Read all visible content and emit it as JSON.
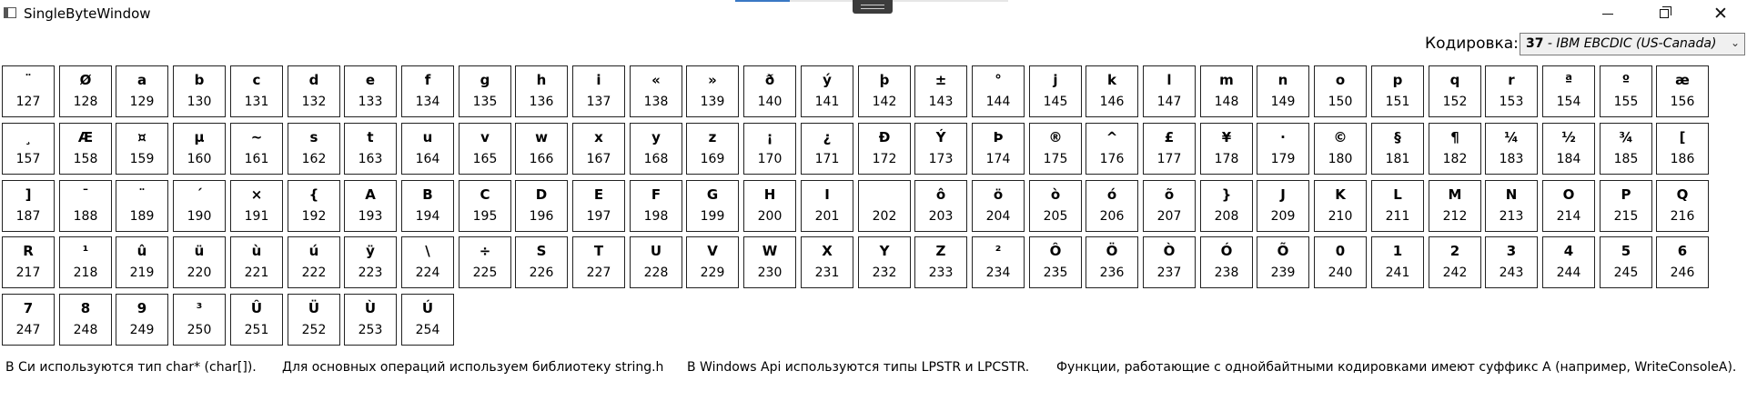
{
  "window": {
    "title": "SingleByteWindow",
    "close_glyph": "✕"
  },
  "encoding": {
    "label": "Кодировка:",
    "selected_number": "37",
    "selected_name": " - IBM EBCDIC (US-Canada)",
    "chevron": "⌄"
  },
  "cells": [
    {
      "ch": "¨",
      "code": "127"
    },
    {
      "ch": "Ø",
      "code": "128"
    },
    {
      "ch": "a",
      "code": "129"
    },
    {
      "ch": "b",
      "code": "130"
    },
    {
      "ch": "c",
      "code": "131"
    },
    {
      "ch": "d",
      "code": "132"
    },
    {
      "ch": "e",
      "code": "133"
    },
    {
      "ch": "f",
      "code": "134"
    },
    {
      "ch": "g",
      "code": "135"
    },
    {
      "ch": "h",
      "code": "136"
    },
    {
      "ch": "i",
      "code": "137"
    },
    {
      "ch": "«",
      "code": "138"
    },
    {
      "ch": "»",
      "code": "139"
    },
    {
      "ch": "ð",
      "code": "140"
    },
    {
      "ch": "ý",
      "code": "141"
    },
    {
      "ch": "þ",
      "code": "142"
    },
    {
      "ch": "±",
      "code": "143"
    },
    {
      "ch": "°",
      "code": "144"
    },
    {
      "ch": "j",
      "code": "145"
    },
    {
      "ch": "k",
      "code": "146"
    },
    {
      "ch": "l",
      "code": "147"
    },
    {
      "ch": "m",
      "code": "148"
    },
    {
      "ch": "n",
      "code": "149"
    },
    {
      "ch": "o",
      "code": "150"
    },
    {
      "ch": "p",
      "code": "151"
    },
    {
      "ch": "q",
      "code": "152"
    },
    {
      "ch": "r",
      "code": "153"
    },
    {
      "ch": "ª",
      "code": "154"
    },
    {
      "ch": "º",
      "code": "155"
    },
    {
      "ch": "æ",
      "code": "156"
    },
    {
      "ch": "¸",
      "code": "157"
    },
    {
      "ch": "Æ",
      "code": "158"
    },
    {
      "ch": "¤",
      "code": "159"
    },
    {
      "ch": "µ",
      "code": "160"
    },
    {
      "ch": "~",
      "code": "161"
    },
    {
      "ch": "s",
      "code": "162"
    },
    {
      "ch": "t",
      "code": "163"
    },
    {
      "ch": "u",
      "code": "164"
    },
    {
      "ch": "v",
      "code": "165"
    },
    {
      "ch": "w",
      "code": "166"
    },
    {
      "ch": "x",
      "code": "167"
    },
    {
      "ch": "y",
      "code": "168"
    },
    {
      "ch": "z",
      "code": "169"
    },
    {
      "ch": "¡",
      "code": "170"
    },
    {
      "ch": "¿",
      "code": "171"
    },
    {
      "ch": "Ð",
      "code": "172"
    },
    {
      "ch": "Ý",
      "code": "173"
    },
    {
      "ch": "Þ",
      "code": "174"
    },
    {
      "ch": "®",
      "code": "175"
    },
    {
      "ch": "^",
      "code": "176"
    },
    {
      "ch": "£",
      "code": "177"
    },
    {
      "ch": "¥",
      "code": "178"
    },
    {
      "ch": "·",
      "code": "179"
    },
    {
      "ch": "©",
      "code": "180"
    },
    {
      "ch": "§",
      "code": "181"
    },
    {
      "ch": "¶",
      "code": "182"
    },
    {
      "ch": "¼",
      "code": "183"
    },
    {
      "ch": "½",
      "code": "184"
    },
    {
      "ch": "¾",
      "code": "185"
    },
    {
      "ch": "[",
      "code": "186"
    },
    {
      "ch": "]",
      "code": "187"
    },
    {
      "ch": "¯",
      "code": "188"
    },
    {
      "ch": "¨",
      "code": "189"
    },
    {
      "ch": "´",
      "code": "190"
    },
    {
      "ch": "×",
      "code": "191"
    },
    {
      "ch": "{",
      "code": "192"
    },
    {
      "ch": "A",
      "code": "193"
    },
    {
      "ch": "B",
      "code": "194"
    },
    {
      "ch": "C",
      "code": "195"
    },
    {
      "ch": "D",
      "code": "196"
    },
    {
      "ch": "E",
      "code": "197"
    },
    {
      "ch": "F",
      "code": "198"
    },
    {
      "ch": "G",
      "code": "199"
    },
    {
      "ch": "H",
      "code": "200"
    },
    {
      "ch": "I",
      "code": "201"
    },
    {
      "ch": "",
      "code": "202"
    },
    {
      "ch": "ô",
      "code": "203"
    },
    {
      "ch": "ö",
      "code": "204"
    },
    {
      "ch": "ò",
      "code": "205"
    },
    {
      "ch": "ó",
      "code": "206"
    },
    {
      "ch": "õ",
      "code": "207"
    },
    {
      "ch": "}",
      "code": "208"
    },
    {
      "ch": "J",
      "code": "209"
    },
    {
      "ch": "K",
      "code": "210"
    },
    {
      "ch": "L",
      "code": "211"
    },
    {
      "ch": "M",
      "code": "212"
    },
    {
      "ch": "N",
      "code": "213"
    },
    {
      "ch": "O",
      "code": "214"
    },
    {
      "ch": "P",
      "code": "215"
    },
    {
      "ch": "Q",
      "code": "216"
    },
    {
      "ch": "R",
      "code": "217"
    },
    {
      "ch": "¹",
      "code": "218"
    },
    {
      "ch": "û",
      "code": "219"
    },
    {
      "ch": "ü",
      "code": "220"
    },
    {
      "ch": "ù",
      "code": "221"
    },
    {
      "ch": "ú",
      "code": "222"
    },
    {
      "ch": "ÿ",
      "code": "223"
    },
    {
      "ch": "\\",
      "code": "224"
    },
    {
      "ch": "÷",
      "code": "225"
    },
    {
      "ch": "S",
      "code": "226"
    },
    {
      "ch": "T",
      "code": "227"
    },
    {
      "ch": "U",
      "code": "228"
    },
    {
      "ch": "V",
      "code": "229"
    },
    {
      "ch": "W",
      "code": "230"
    },
    {
      "ch": "X",
      "code": "231"
    },
    {
      "ch": "Y",
      "code": "232"
    },
    {
      "ch": "Z",
      "code": "233"
    },
    {
      "ch": "²",
      "code": "234"
    },
    {
      "ch": "Ô",
      "code": "235"
    },
    {
      "ch": "Ö",
      "code": "236"
    },
    {
      "ch": "Ò",
      "code": "237"
    },
    {
      "ch": "Ó",
      "code": "238"
    },
    {
      "ch": "Õ",
      "code": "239"
    },
    {
      "ch": "0",
      "code": "240"
    },
    {
      "ch": "1",
      "code": "241"
    },
    {
      "ch": "2",
      "code": "242"
    },
    {
      "ch": "3",
      "code": "243"
    },
    {
      "ch": "4",
      "code": "244"
    },
    {
      "ch": "5",
      "code": "245"
    },
    {
      "ch": "6",
      "code": "246"
    },
    {
      "ch": "7",
      "code": "247"
    },
    {
      "ch": "8",
      "code": "248"
    },
    {
      "ch": "9",
      "code": "249"
    },
    {
      "ch": "³",
      "code": "250"
    },
    {
      "ch": "Û",
      "code": "251"
    },
    {
      "ch": "Ü",
      "code": "252"
    },
    {
      "ch": "Ù",
      "code": "253"
    },
    {
      "ch": "Ú",
      "code": "254"
    }
  ],
  "notes": [
    "В Си используются тип char* (char[]).",
    "Для основных операций используем библиотеку string.h",
    "В Windows Api используются типы LPSTR и LPCSTR.",
    "Функции, работающие с однойбайтными кодировками имеют суффикс A (например, WriteConsoleA)."
  ]
}
